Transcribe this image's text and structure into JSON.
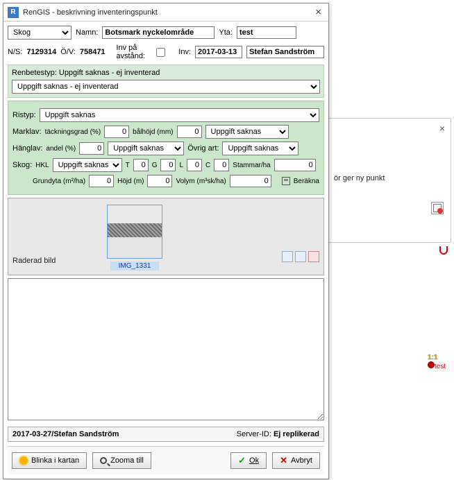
{
  "window": {
    "title": "RenGIS - beskrivning inventeringspunkt",
    "logo": "R"
  },
  "header": {
    "type_value": "Skog",
    "namn_label": "Namn:",
    "namn_value": "Botsmark nyckelområde",
    "yta_label": "Yta:",
    "yta_value": "test",
    "ns_label": "N/S:",
    "ns_value": "7129314",
    "ov_label": "Ö/V:",
    "ov_value": "758471",
    "inv_dist_label": "Inv på avstånd:",
    "inv_label": "Inv:",
    "inv_date": "2017-03-13",
    "inv_user": "Stefan Sandström"
  },
  "renbetestyp": {
    "label": "Renbetestyp: Uppgift saknas - ej inventerad",
    "select": "Uppgift saknas - ej inventerad"
  },
  "ristyp": {
    "label": "Ristyp:",
    "value": "Uppgift saknas"
  },
  "marklav": {
    "label": "Marklav:",
    "tack_label": "täckningsgrad (%)",
    "tack_val": "0",
    "balh_label": "bålhöjd (mm)",
    "balh_val": "0",
    "sel": "Uppgift saknas"
  },
  "hanglav": {
    "label": "Hänglav:",
    "andel_label": "andel (%)",
    "andel_val": "0",
    "sel": "Uppgift saknas",
    "ovrig_label": "Övrig art:",
    "ovrig_sel": "Uppgift saknas"
  },
  "skog": {
    "label": "Skog:",
    "hkl_label": "HKL",
    "hkl_sel": "Uppgift saknas",
    "t": "T",
    "t_val": "0",
    "g": "G",
    "g_val": "0",
    "l": "L",
    "l_val": "0",
    "c": "C",
    "c_val": "0",
    "stammar_label": "Stammar/ha",
    "stammar_val": "0",
    "grundyta_label": "Grundyta (m²/ha)",
    "grundyta_val": "0",
    "hojd_label": "Höjd (m)",
    "hojd_val": "0",
    "volym_label": "Volym (m³sk/ha)",
    "volym_val": "0",
    "berakna": "Beräkna"
  },
  "image": {
    "caption": "Raderad bild",
    "filename": "IMG_1331"
  },
  "status": {
    "left": "2017-03-27/Stefan Sandström",
    "right_label": "Server-ID:",
    "right_val": "Ej replikerad"
  },
  "footer": {
    "blinka": "Blinka i kartan",
    "zooma": "Zooma till",
    "ok": "Ok",
    "avbryt": "Avbryt"
  },
  "bg": {
    "hint": "ör ger ny punkt",
    "scale": "1:1",
    "point_label": "test"
  }
}
